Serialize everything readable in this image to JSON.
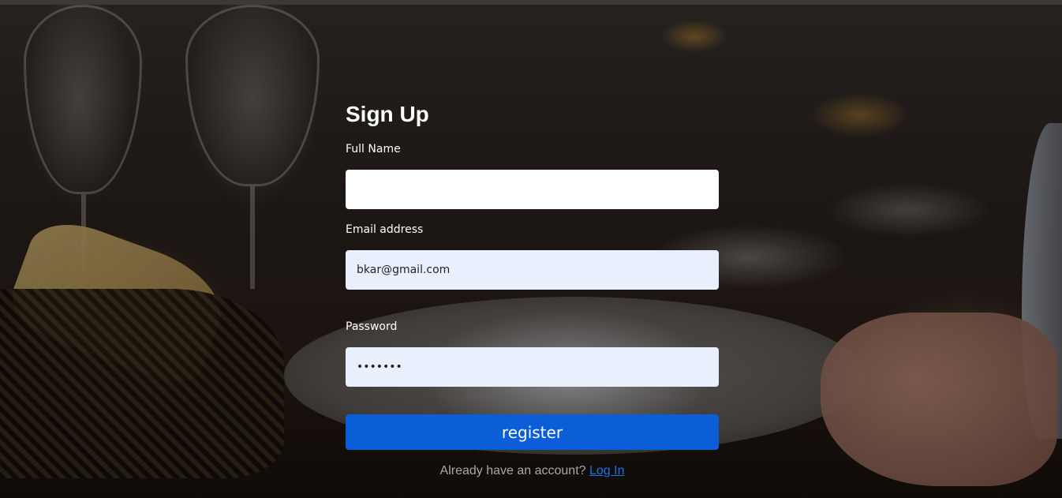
{
  "form": {
    "title": "Sign Up",
    "full_name": {
      "label": "Full Name",
      "value": ""
    },
    "email": {
      "label": "Email address",
      "value": "bkar@gmail.com"
    },
    "password": {
      "label": "Password",
      "value": "1234567"
    },
    "submit_label": "register",
    "footer_text": "Already have an account?",
    "login_link": "Log In"
  },
  "colors": {
    "button": "#0b5ed7",
    "autofill": "#e8f0fe",
    "link": "#1a73e8"
  },
  "background": {
    "image": "restaurant-table-photo"
  }
}
